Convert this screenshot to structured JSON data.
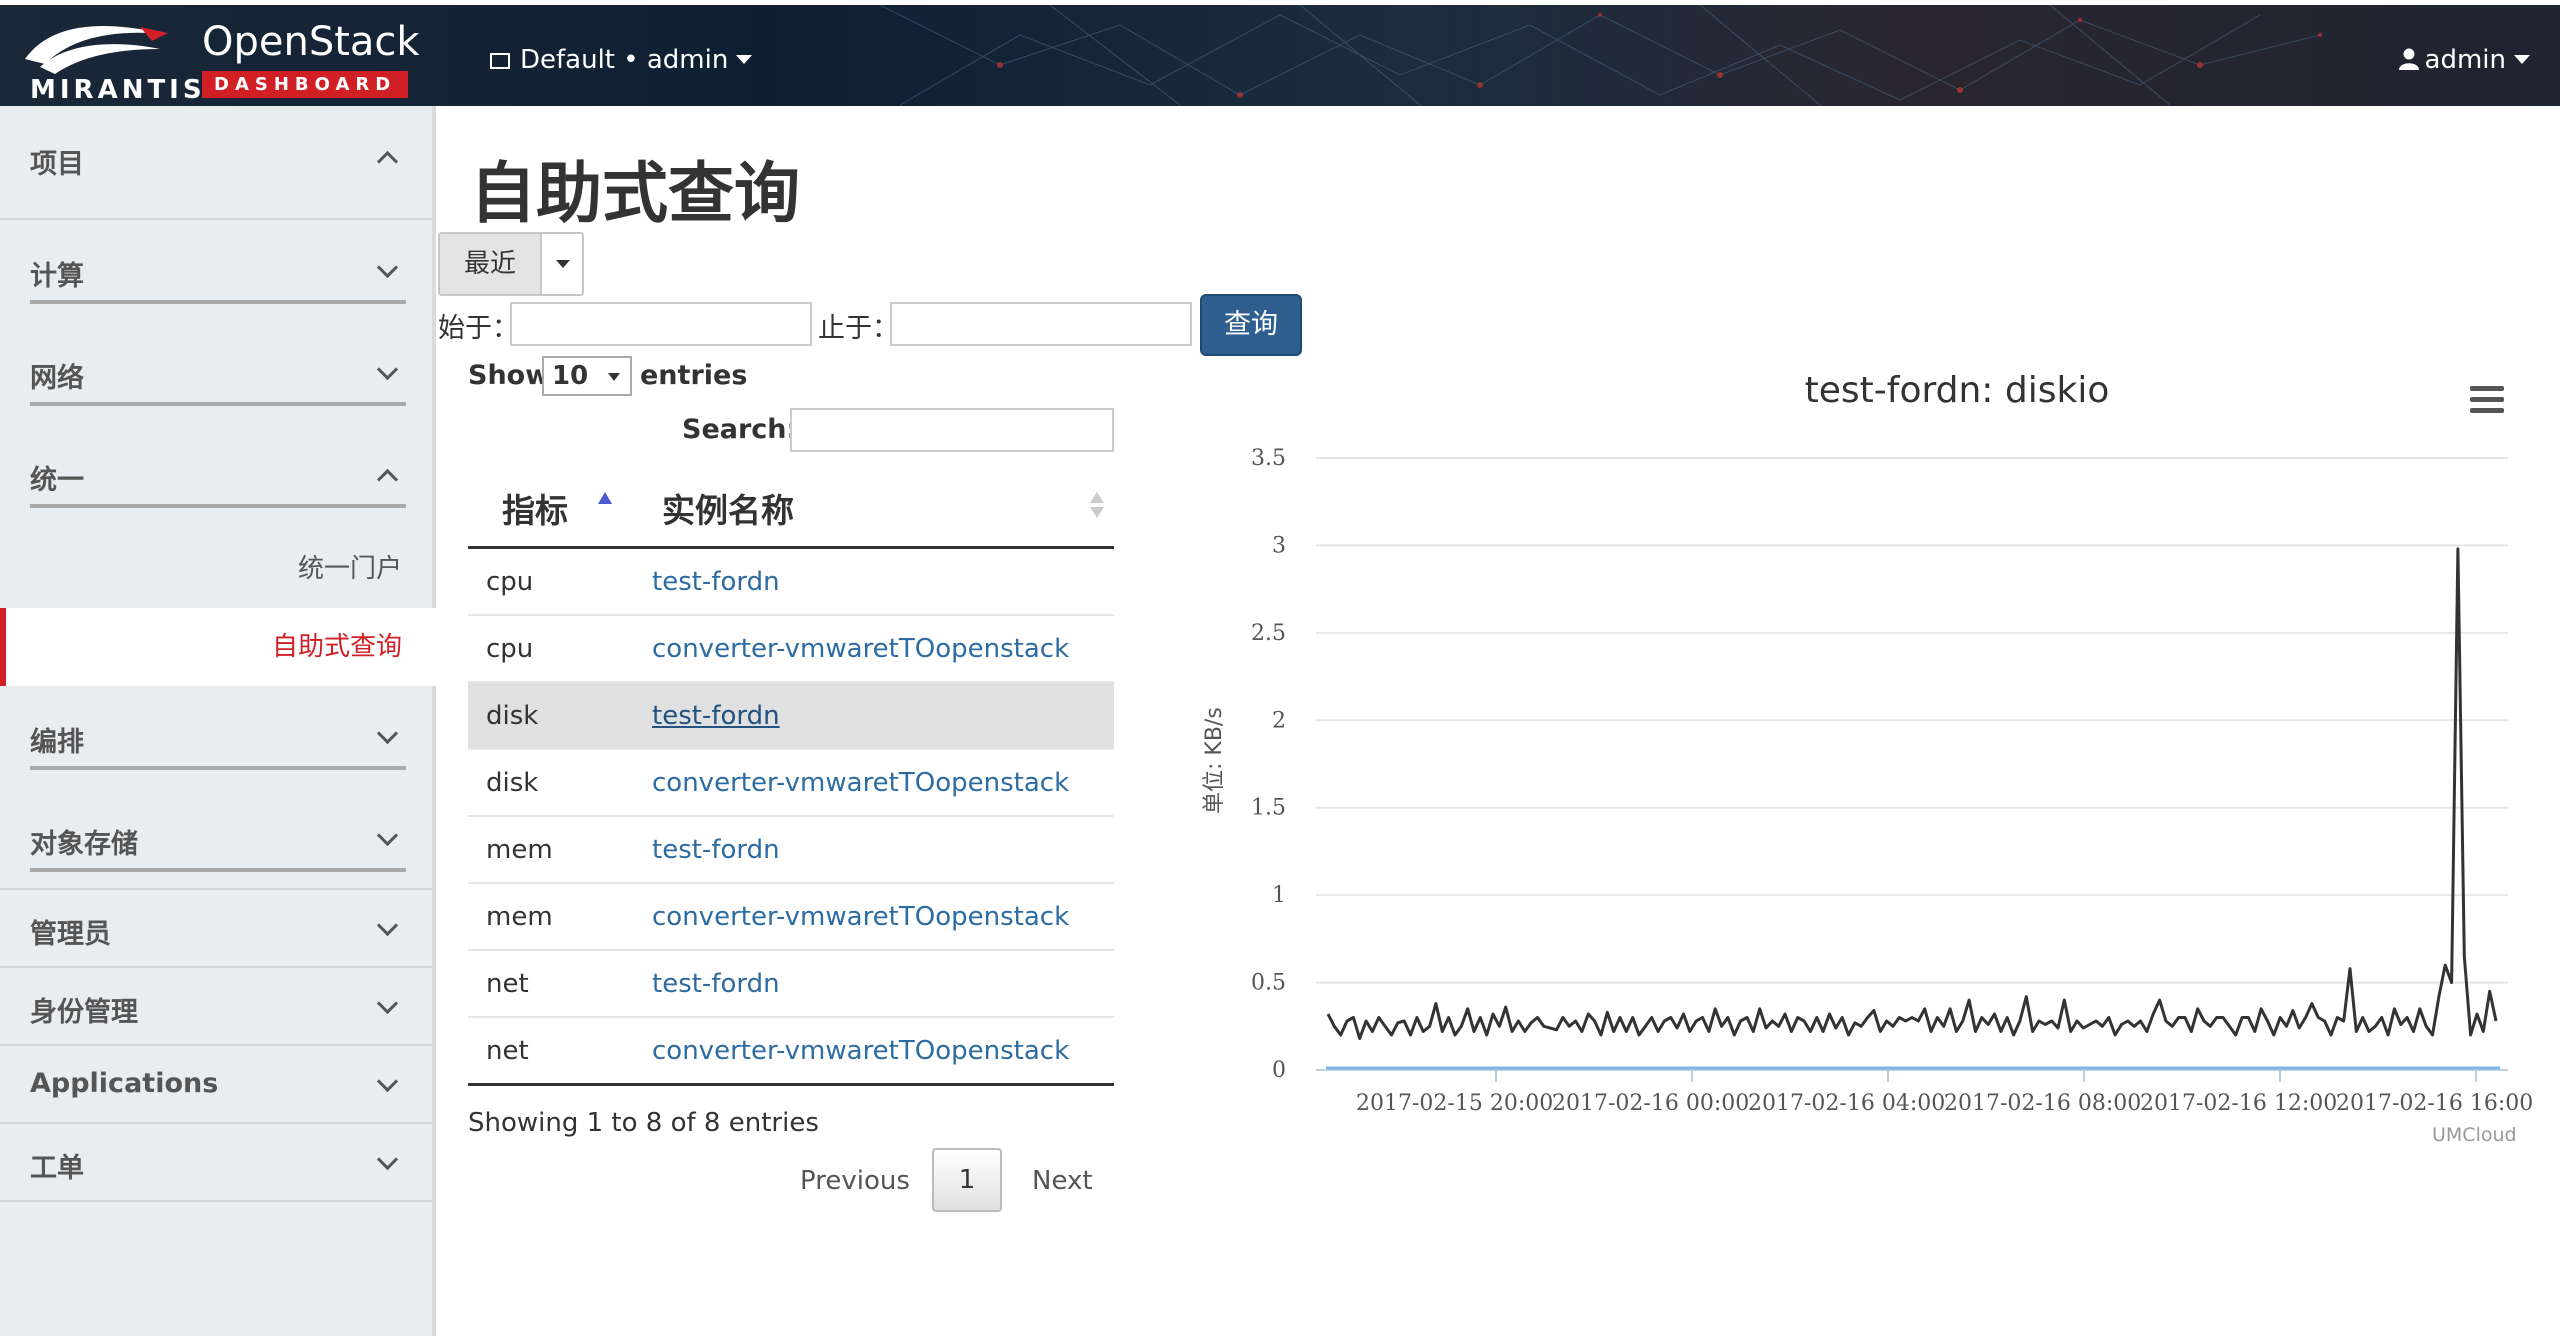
{
  "header": {
    "brand_top": "OpenStack",
    "brand_badge": "DASHBOARD",
    "brand_logo": "MIRANTIS",
    "project_selector": "Default • admin",
    "user_menu": "admin"
  },
  "sidebar": {
    "items": [
      {
        "label": "项目",
        "expanded": true
      },
      {
        "label": "计算",
        "expanded": false
      },
      {
        "label": "网络",
        "expanded": false
      },
      {
        "label": "统一",
        "expanded": true
      },
      {
        "label": "编排",
        "expanded": false
      },
      {
        "label": "对象存储",
        "expanded": false
      },
      {
        "label": "管理员",
        "expanded": false
      },
      {
        "label": "身份管理",
        "expanded": false
      },
      {
        "label": "Applications",
        "expanded": false
      },
      {
        "label": "工单",
        "expanded": false
      }
    ],
    "sub_items": [
      {
        "label": "统一门户",
        "active": false
      },
      {
        "label": "自助式查询",
        "active": true
      }
    ]
  },
  "main": {
    "title": "自助式查询",
    "range_button": "最近",
    "from_label": "始于：",
    "to_label": "止于：",
    "from_value": "",
    "to_value": "",
    "query_button": "查询",
    "show_label": "Show",
    "page_length": "10",
    "entries_label": "entries",
    "search_label": "Search:",
    "search_value": "",
    "table": {
      "columns": [
        "指标",
        "实例名称"
      ],
      "rows": [
        [
          "cpu",
          "test-fordn"
        ],
        [
          "cpu",
          "converter-vmwaretTOopenstack"
        ],
        [
          "disk",
          "test-fordn"
        ],
        [
          "disk",
          "converter-vmwaretTOopenstack"
        ],
        [
          "mem",
          "test-fordn"
        ],
        [
          "mem",
          "converter-vmwaretTOopenstack"
        ],
        [
          "net",
          "test-fordn"
        ],
        [
          "net",
          "converter-vmwaretTOopenstack"
        ]
      ]
    },
    "info_text": "Showing 1 to 8 of 8 entries",
    "pagination": {
      "previous": "Previous",
      "current": "1",
      "next": "Next"
    }
  },
  "chart_data": {
    "type": "line",
    "title": "test-fordn: diskio",
    "ylabel": "单位: KB/s",
    "xlabel": "",
    "credit": "UMCloud",
    "ylim": [
      0,
      3.5
    ],
    "yticks": [
      "0",
      "0.5",
      "1",
      "1.5",
      "2",
      "2.5",
      "3",
      "3.5"
    ],
    "xticks": [
      "2017-02-15 20:00",
      "2017-02-16 00:00",
      "2017-02-16 04:00",
      "2017-02-16 08:00",
      "2017-02-16 12:00",
      "2017-02-16 16:00"
    ],
    "series": [
      {
        "color": "#333333",
        "values": [
          0.32,
          0.25,
          0.2,
          0.28,
          0.3,
          0.18,
          0.28,
          0.22,
          0.3,
          0.25,
          0.2,
          0.27,
          0.28,
          0.2,
          0.3,
          0.22,
          0.25,
          0.38,
          0.22,
          0.3,
          0.2,
          0.25,
          0.35,
          0.22,
          0.3,
          0.2,
          0.32,
          0.25,
          0.36,
          0.22,
          0.28,
          0.22,
          0.27,
          0.3,
          0.25,
          0.24,
          0.23,
          0.3,
          0.25,
          0.28,
          0.22,
          0.32,
          0.28,
          0.2,
          0.33,
          0.22,
          0.3,
          0.22,
          0.3,
          0.2,
          0.25,
          0.3,
          0.22,
          0.28,
          0.3,
          0.24,
          0.32,
          0.22,
          0.28,
          0.3,
          0.22,
          0.35,
          0.25,
          0.3,
          0.2,
          0.28,
          0.3,
          0.22,
          0.35,
          0.24,
          0.28,
          0.25,
          0.32,
          0.22,
          0.3,
          0.28,
          0.22,
          0.3,
          0.22,
          0.32,
          0.24,
          0.3,
          0.2,
          0.27,
          0.25,
          0.3,
          0.34,
          0.22,
          0.28,
          0.25,
          0.3,
          0.28,
          0.3,
          0.28,
          0.35,
          0.22,
          0.3,
          0.25,
          0.35,
          0.22,
          0.28,
          0.4,
          0.22,
          0.3,
          0.26,
          0.32,
          0.22,
          0.3,
          0.2,
          0.28,
          0.42,
          0.22,
          0.28,
          0.26,
          0.28,
          0.24,
          0.4,
          0.22,
          0.28,
          0.24,
          0.26,
          0.28,
          0.25,
          0.3,
          0.2,
          0.26,
          0.28,
          0.25,
          0.28,
          0.22,
          0.32,
          0.4,
          0.28,
          0.25,
          0.3,
          0.3,
          0.22,
          0.35,
          0.28,
          0.25,
          0.3,
          0.3,
          0.25,
          0.2,
          0.3,
          0.3,
          0.22,
          0.35,
          0.28,
          0.2,
          0.3,
          0.25,
          0.34,
          0.24,
          0.3,
          0.38,
          0.3,
          0.28,
          0.2,
          0.3,
          0.28,
          0.58,
          0.22,
          0.3,
          0.22,
          0.25,
          0.3,
          0.2,
          0.35,
          0.26,
          0.3,
          0.22,
          0.35,
          0.25,
          0.2,
          0.42,
          0.6,
          0.5,
          2.98,
          0.65,
          0.2,
          0.32,
          0.22,
          0.45,
          0.28
        ]
      },
      {
        "color": "#7cb5ec",
        "values": "flat at 0"
      }
    ]
  }
}
